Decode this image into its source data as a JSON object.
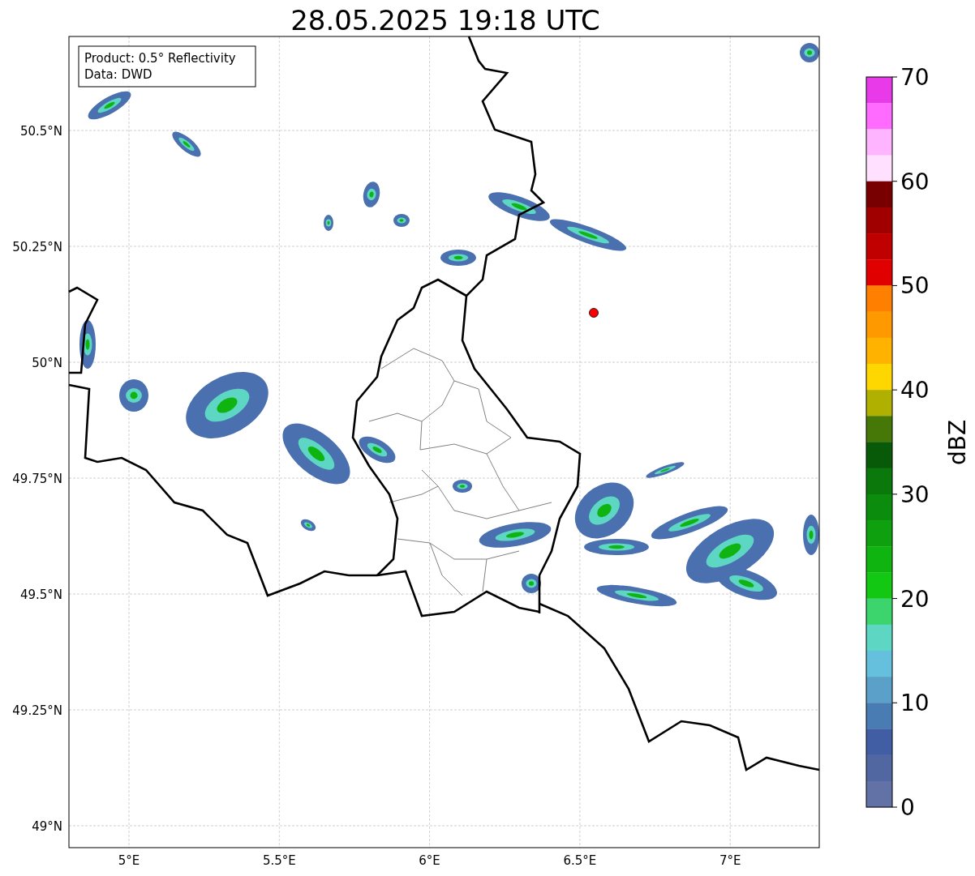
{
  "title": "28.05.2025 19:18 UTC",
  "info_box": [
    "Product: 0.5° Reflectivity",
    "Data: DWD"
  ],
  "map": {
    "xticks": [
      "5°E",
      "5.5°E",
      "6°E",
      "6.5°E",
      "7°E"
    ],
    "yticks": [
      "50.5°N",
      "50.25°N",
      "50°N",
      "49.75°N",
      "49.5°N",
      "49.25°N",
      "49°N"
    ]
  },
  "colorbar": {
    "label": "dBZ",
    "ticks": [
      "70",
      "60",
      "50",
      "40",
      "30",
      "20",
      "10",
      "0"
    ],
    "bins": [
      {
        "color": "#e83ae8"
      },
      {
        "color": "#ff6aff"
      },
      {
        "color": "#ffb4ff"
      },
      {
        "color": "#ffe0ff"
      },
      {
        "color": "#780000"
      },
      {
        "color": "#a00000"
      },
      {
        "color": "#c00000"
      },
      {
        "color": "#e00000"
      },
      {
        "color": "#ff7f00"
      },
      {
        "color": "#ff9900"
      },
      {
        "color": "#ffb300"
      },
      {
        "color": "#ffd700"
      },
      {
        "color": "#b0b000"
      },
      {
        "color": "#467808"
      },
      {
        "color": "#085a08"
      },
      {
        "color": "#0a780a"
      },
      {
        "color": "#0c8c0c"
      },
      {
        "color": "#0ea00e"
      },
      {
        "color": "#10b410"
      },
      {
        "color": "#12c812"
      },
      {
        "color": "#3cd46c"
      },
      {
        "color": "#5ed6c4"
      },
      {
        "color": "#64c0dc"
      },
      {
        "color": "#5aa0c8"
      },
      {
        "color": "#4a7cb4"
      },
      {
        "color": "#415ea4"
      },
      {
        "color": "#5167a2"
      },
      {
        "color": "#6272a6"
      }
    ]
  }
}
